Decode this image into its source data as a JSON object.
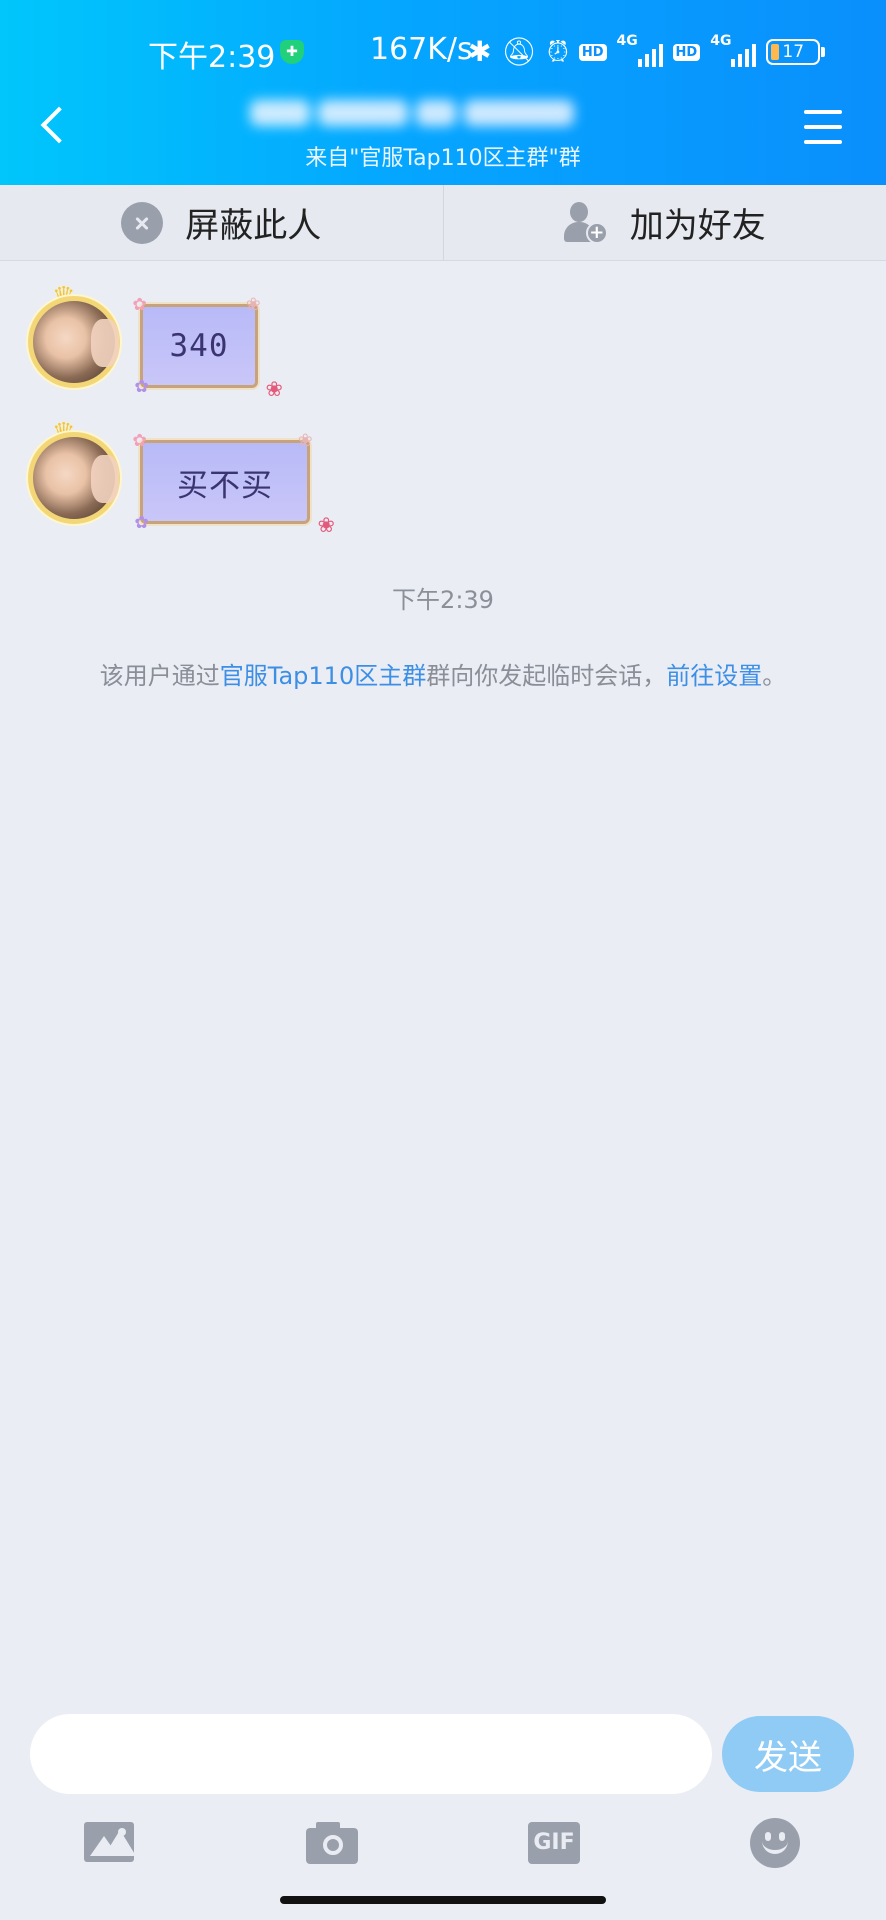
{
  "status_bar": {
    "time": "下午2:39",
    "net_speed": "167K/s",
    "hd": "HD",
    "network_type": "4G",
    "battery": "17",
    "icons": [
      "vpn-shield-icon",
      "bluetooth-icon",
      "mute-bell-icon",
      "alarm-icon",
      "signal-icon",
      "battery-icon"
    ]
  },
  "header": {
    "subtitle": "来自\"官服Tap110区主群\"群"
  },
  "actions": {
    "block_label": "屏蔽此人",
    "add_friend_label": "加为好友"
  },
  "messages": [
    {
      "text": "340"
    },
    {
      "text": "买不买"
    }
  ],
  "timestamp": "下午2:39",
  "notice": {
    "prefix": "该用户通过",
    "group_link": "官服Tap110区主群",
    "middle": "群向你发起临时会话，",
    "settings_link": "前往设置",
    "suffix": "。"
  },
  "input": {
    "value": "",
    "send_label": "发送"
  },
  "toolbar": {
    "gif_label": "GIF"
  },
  "colors": {
    "header_gradient_start": "#00c6fb",
    "header_gradient_end": "#0a8ffc",
    "link": "#3d8fe6",
    "send_button": "#8fcbf4",
    "background": "#eaedf4"
  }
}
